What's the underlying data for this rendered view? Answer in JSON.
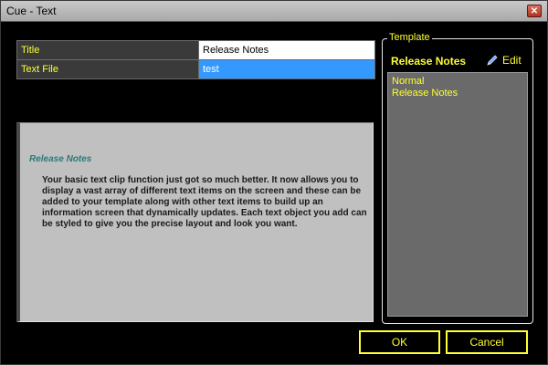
{
  "window": {
    "title": "Cue - Text",
    "close_glyph": "✕"
  },
  "properties": [
    {
      "name": "Title",
      "value": "Release Notes"
    },
    {
      "name": "Text File",
      "value": "test"
    }
  ],
  "preview": {
    "heading": "Release Notes",
    "body": "Your basic text clip function just got so much better. It now allows you to display a vast array of different text items on the screen and these can be added to your template along with other text items to build up an information screen that dynamically updates. Each text object you add can be styled to give you the precise layout and look you want."
  },
  "template": {
    "legend": "Template",
    "selected_name": "Release Notes",
    "edit_label": "Edit",
    "items": [
      "Normal",
      "Release Notes"
    ]
  },
  "buttons": {
    "ok": "OK",
    "cancel": "Cancel"
  },
  "colors": {
    "accent": "#ffff33",
    "selection": "#3399ff",
    "preview_heading": "#2a7a7a"
  }
}
